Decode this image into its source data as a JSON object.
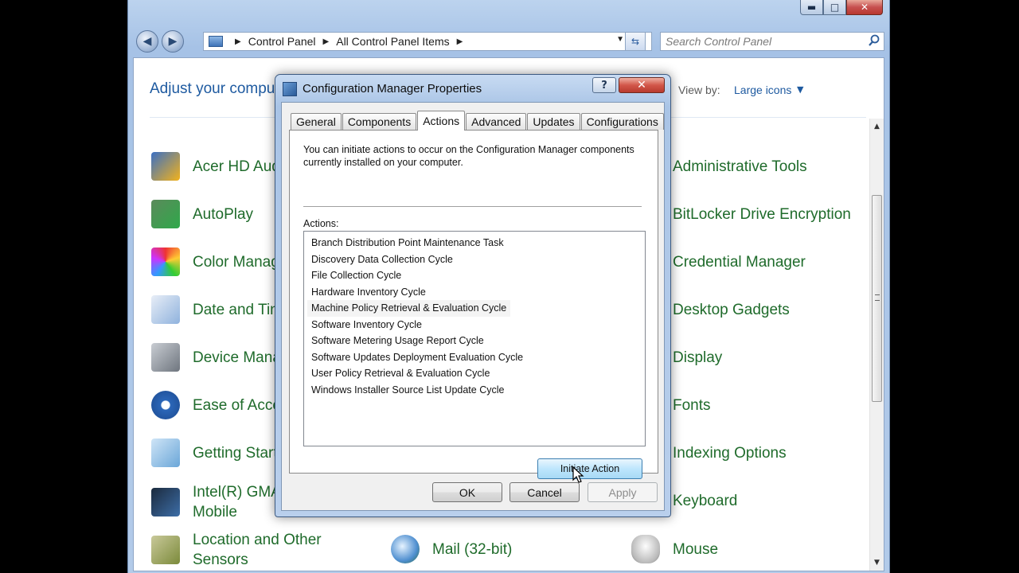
{
  "control_panel": {
    "breadcrumb": [
      "Control Panel",
      "All Control Panel Items"
    ],
    "search_placeholder": "Search Control Panel",
    "heading": "Adjust your compu",
    "view_by_label": "View by:",
    "view_by_value": "Large icons",
    "items_left": [
      {
        "label": "Acer HD Aud",
        "icon": "audio-icon"
      },
      {
        "label": "AutoPlay",
        "icon": "autoplay-icon"
      },
      {
        "label": "Color Manag",
        "icon": "color-management-icon"
      },
      {
        "label": "Date and Tin",
        "icon": "date-time-icon"
      },
      {
        "label": "Device Mana",
        "icon": "device-manager-icon"
      },
      {
        "label": "Ease of Acce",
        "icon": "ease-of-access-icon"
      },
      {
        "label": "Getting Start",
        "icon": "getting-started-icon"
      },
      {
        "label": "Intel(R) GMA",
        "label2": "Mobile",
        "icon": "intel-gma-icon"
      },
      {
        "label": "Location and Other",
        "label2": "Sensors",
        "icon": "location-sensors-icon"
      }
    ],
    "items_mid": [
      {
        "label": "Mail (32-bit)",
        "icon": "mail-icon"
      }
    ],
    "items_right": [
      {
        "label": "Administrative Tools",
        "icon": "admin-tools-icon"
      },
      {
        "label": "BitLocker Drive Encryption",
        "icon": "bitlocker-icon"
      },
      {
        "label": "Credential Manager",
        "icon": "credential-manager-icon"
      },
      {
        "label": "Desktop Gadgets",
        "icon": "desktop-gadgets-icon"
      },
      {
        "label": "Display",
        "icon": "display-icon"
      },
      {
        "label": "Fonts",
        "icon": "fonts-icon"
      },
      {
        "label": "Indexing Options",
        "icon": "indexing-options-icon"
      },
      {
        "label": "Keyboard",
        "icon": "keyboard-icon"
      },
      {
        "label": "Mouse",
        "icon": "mouse-icon"
      }
    ]
  },
  "dialog": {
    "title": "Configuration Manager Properties",
    "help": "?",
    "close": "✕",
    "tabs": [
      "General",
      "Components",
      "Actions",
      "Advanced",
      "Updates",
      "Configurations"
    ],
    "active_tab": "Actions",
    "intro": "You can initiate actions to occur on the Configuration Manager components currently installed on your computer.",
    "actions_label": "Actions:",
    "actions": [
      "Branch Distribution Point Maintenance Task",
      "Discovery Data Collection Cycle",
      "File Collection Cycle",
      "Hardware Inventory Cycle",
      "Machine Policy Retrieval & Evaluation Cycle",
      "Software Inventory Cycle",
      "Software Metering Usage Report Cycle",
      "Software Updates Deployment Evaluation Cycle",
      "User Policy Retrieval & Evaluation Cycle",
      "Windows Installer Source List Update Cycle"
    ],
    "initiate_label": "Initiate Action",
    "ok_label": "OK",
    "cancel_label": "Cancel",
    "apply_label": "Apply"
  },
  "window_controls": {
    "minimize": "▬",
    "maximize": "□",
    "close": "✕"
  }
}
